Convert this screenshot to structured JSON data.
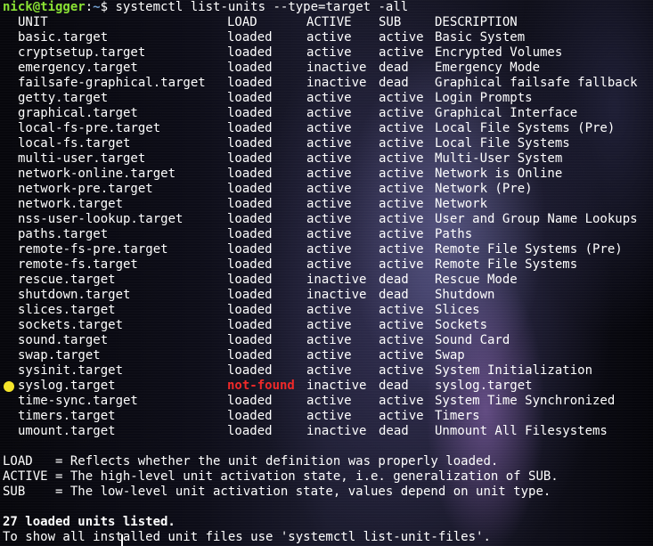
{
  "prompt": {
    "user_host": "nick@tigger",
    "separator": ":",
    "path": "~",
    "symbol": "$",
    "command": "systemctl list-units --type=target -all"
  },
  "header": {
    "unit": "UNIT",
    "load": "LOAD",
    "active": "ACTIVE",
    "sub": "SUB",
    "description": "DESCRIPTION"
  },
  "rows": [
    {
      "unit": "basic.target",
      "load": "loaded",
      "active": "active",
      "sub": "active",
      "description": "Basic System"
    },
    {
      "unit": "cryptsetup.target",
      "load": "loaded",
      "active": "active",
      "sub": "active",
      "description": "Encrypted Volumes"
    },
    {
      "unit": "emergency.target",
      "load": "loaded",
      "active": "inactive",
      "sub": "dead",
      "description": "Emergency Mode"
    },
    {
      "unit": "failsafe-graphical.target",
      "load": "loaded",
      "active": "inactive",
      "sub": "dead",
      "description": "Graphical failsafe fallback"
    },
    {
      "unit": "getty.target",
      "load": "loaded",
      "active": "active",
      "sub": "active",
      "description": "Login Prompts"
    },
    {
      "unit": "graphical.target",
      "load": "loaded",
      "active": "active",
      "sub": "active",
      "description": "Graphical Interface"
    },
    {
      "unit": "local-fs-pre.target",
      "load": "loaded",
      "active": "active",
      "sub": "active",
      "description": "Local File Systems (Pre)"
    },
    {
      "unit": "local-fs.target",
      "load": "loaded",
      "active": "active",
      "sub": "active",
      "description": "Local File Systems"
    },
    {
      "unit": "multi-user.target",
      "load": "loaded",
      "active": "active",
      "sub": "active",
      "description": "Multi-User System"
    },
    {
      "unit": "network-online.target",
      "load": "loaded",
      "active": "active",
      "sub": "active",
      "description": "Network is Online"
    },
    {
      "unit": "network-pre.target",
      "load": "loaded",
      "active": "active",
      "sub": "active",
      "description": "Network (Pre)"
    },
    {
      "unit": "network.target",
      "load": "loaded",
      "active": "active",
      "sub": "active",
      "description": "Network"
    },
    {
      "unit": "nss-user-lookup.target",
      "load": "loaded",
      "active": "active",
      "sub": "active",
      "description": "User and Group Name Lookups"
    },
    {
      "unit": "paths.target",
      "load": "loaded",
      "active": "active",
      "sub": "active",
      "description": "Paths"
    },
    {
      "unit": "remote-fs-pre.target",
      "load": "loaded",
      "active": "active",
      "sub": "active",
      "description": "Remote File Systems (Pre)"
    },
    {
      "unit": "remote-fs.target",
      "load": "loaded",
      "active": "active",
      "sub": "active",
      "description": "Remote File Systems"
    },
    {
      "unit": "rescue.target",
      "load": "loaded",
      "active": "inactive",
      "sub": "dead",
      "description": "Rescue Mode"
    },
    {
      "unit": "shutdown.target",
      "load": "loaded",
      "active": "inactive",
      "sub": "dead",
      "description": "Shutdown"
    },
    {
      "unit": "slices.target",
      "load": "loaded",
      "active": "active",
      "sub": "active",
      "description": "Slices"
    },
    {
      "unit": "sockets.target",
      "load": "loaded",
      "active": "active",
      "sub": "active",
      "description": "Sockets"
    },
    {
      "unit": "sound.target",
      "load": "loaded",
      "active": "active",
      "sub": "active",
      "description": "Sound Card"
    },
    {
      "unit": "swap.target",
      "load": "loaded",
      "active": "active",
      "sub": "active",
      "description": "Swap"
    },
    {
      "unit": "sysinit.target",
      "load": "loaded",
      "active": "active",
      "sub": "active",
      "description": "System Initialization"
    },
    {
      "unit": "syslog.target",
      "load": "not-found",
      "active": "inactive",
      "sub": "dead",
      "description": "syslog.target"
    },
    {
      "unit": "time-sync.target",
      "load": "loaded",
      "active": "active",
      "sub": "active",
      "description": "System Time Synchronized"
    },
    {
      "unit": "timers.target",
      "load": "loaded",
      "active": "active",
      "sub": "active",
      "description": "Timers"
    },
    {
      "unit": "umount.target",
      "load": "loaded",
      "active": "inactive",
      "sub": "dead",
      "description": "Unmount All Filesystems"
    }
  ],
  "legend": {
    "load": "LOAD   = Reflects whether the unit definition was properly loaded.",
    "active": "ACTIVE = The high-level unit activation state, i.e. generalization of SUB.",
    "sub": "SUB    = The low-level unit activation state, values depend on unit type."
  },
  "summary": "27 loaded units listed.",
  "hint": "To show all installed unit files use 'systemctl list-unit-files'.",
  "colors": {
    "prompt_user": "#8ae234",
    "prompt_path": "#729fcf",
    "not_found": "#ef2929",
    "failed_dot": "#f5e52a",
    "text": "#ffffff"
  }
}
